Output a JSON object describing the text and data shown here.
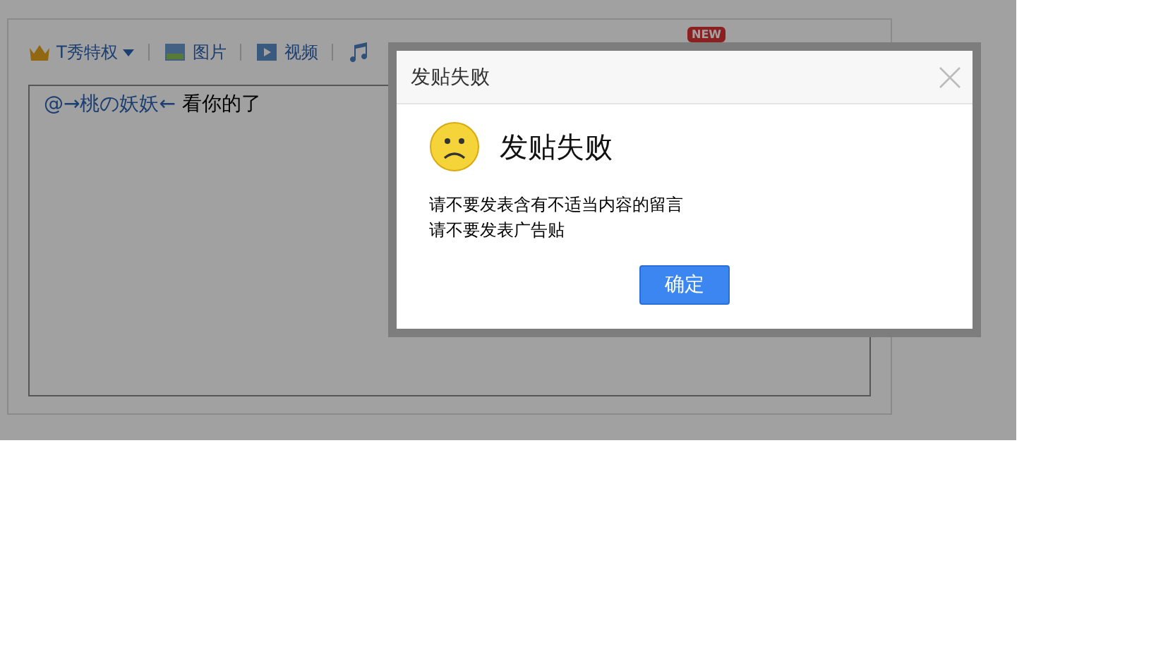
{
  "toolbar": {
    "items": [
      {
        "kind": "crown",
        "label": "T秀特权",
        "dropdown": true
      },
      {
        "kind": "image",
        "label": "图片"
      },
      {
        "kind": "video",
        "label": "视频"
      },
      {
        "kind": "music"
      }
    ],
    "badge": "NEW"
  },
  "editor": {
    "mention": "@→桃の妖妖←",
    "text": " 看你的了"
  },
  "dialog": {
    "title": "发贴失败",
    "heading": "发贴失败",
    "messages": [
      "请不要发表含有不适当内容的留言",
      "请不要发表广告贴"
    ],
    "button": "确定"
  }
}
